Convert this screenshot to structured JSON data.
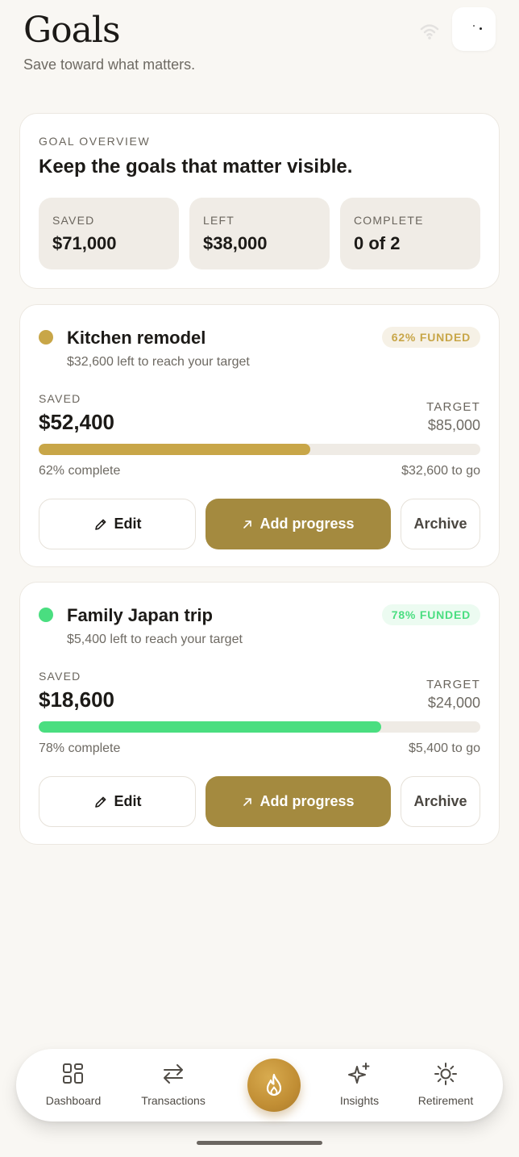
{
  "header": {
    "title": "Goals",
    "subtitle": "Save toward what matters."
  },
  "overview": {
    "eyebrow": "GOAL OVERVIEW",
    "headline": "Keep the goals that matter visible.",
    "stats": [
      {
        "label": "SAVED",
        "value": "$71,000"
      },
      {
        "label": "LEFT",
        "value": "$38,000"
      },
      {
        "label": "COMPLETE",
        "value": "0 of 2"
      }
    ]
  },
  "goals": [
    {
      "name": "Kitchen remodel",
      "subtitle": "$32,600 left to reach your target",
      "badge": "62% FUNDED",
      "color": "#c8a648",
      "badge_bg": "#f6f1e6",
      "saved_label": "SAVED",
      "saved": "$52,400",
      "target_label": "TARGET",
      "target": "$85,000",
      "progress_percent": 61.5,
      "complete_text": "62% complete",
      "to_go": "$32,600 to go",
      "edit_label": "Edit",
      "add_label": "Add progress",
      "archive_label": "Archive"
    },
    {
      "name": "Family Japan trip",
      "subtitle": "$5,400 left to reach your target",
      "badge": "78% FUNDED",
      "color": "#4ade80",
      "badge_bg": "#ecfbf1",
      "saved_label": "SAVED",
      "saved": "$18,600",
      "target_label": "TARGET",
      "target": "$24,000",
      "progress_percent": 77.5,
      "complete_text": "78% complete",
      "to_go": "$5,400 to go",
      "edit_label": "Edit",
      "add_label": "Add progress",
      "archive_label": "Archive"
    }
  ],
  "nav": {
    "items": [
      {
        "label": "Dashboard",
        "icon": "grid-icon"
      },
      {
        "label": "Transactions",
        "icon": "swap-arrows-icon"
      },
      {
        "label": "Insights",
        "icon": "sparkle-icon"
      },
      {
        "label": "Retirement",
        "icon": "sun-icon"
      }
    ],
    "center_icon": "flame-icon"
  },
  "colors": {
    "accent": "#a48a3f",
    "background": "#f9f7f3"
  }
}
